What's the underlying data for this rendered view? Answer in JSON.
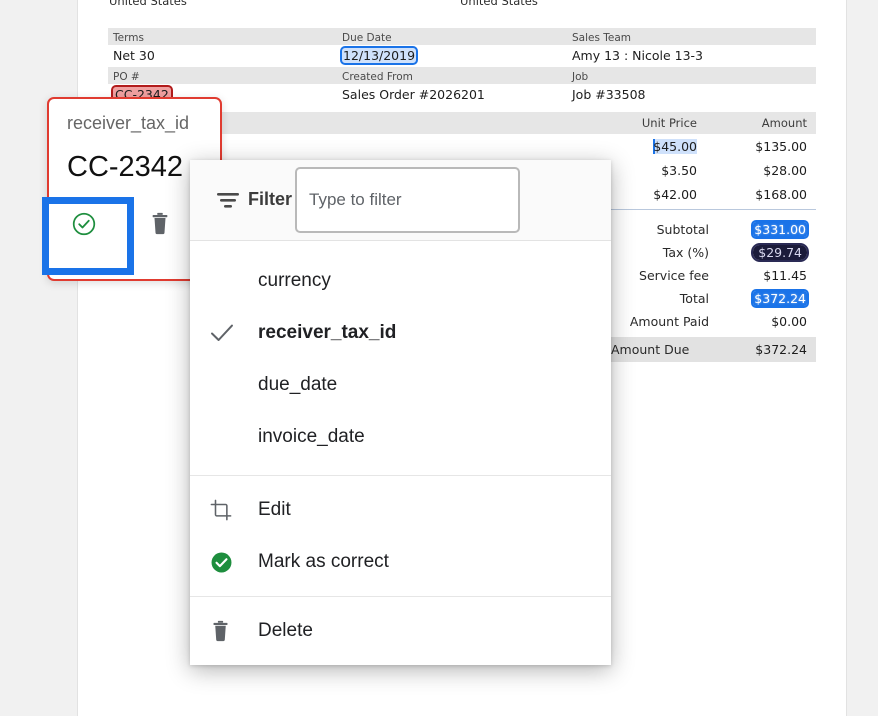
{
  "document": {
    "address_left": "United States",
    "address_right": "United States",
    "meta_rows": [
      {
        "headers": [
          "Terms",
          "Due Date",
          "Sales Team"
        ],
        "values": [
          "Net 30",
          "12/13/2019",
          "Amy 13 : Nicole 13-3"
        ],
        "highlight": [
          "none",
          "blue",
          "none"
        ]
      },
      {
        "headers": [
          "PO #",
          "Created From",
          "Job"
        ],
        "values": [
          "CC-2342",
          "Sales Order #2026201",
          "Job #33508"
        ],
        "highlight": [
          "red",
          "none",
          "none"
        ]
      }
    ],
    "line_items": {
      "headers": [
        "",
        "Unit Price",
        "Amount"
      ],
      "rows": [
        {
          "description": "",
          "unit_price": "$45.00",
          "amount": "$135.00",
          "unit_price_highlight": "caret"
        },
        {
          "description": "",
          "unit_price": "$3.50",
          "amount": "$28.00",
          "unit_price_highlight": "none"
        },
        {
          "description": "",
          "unit_price": "$42.00",
          "amount": "$168.00",
          "unit_price_highlight": "none"
        }
      ]
    },
    "totals": [
      {
        "label": "Subtotal",
        "value": "$331.00",
        "highlight": "blue-solid"
      },
      {
        "label": "Tax (%)",
        "value": "$29.74",
        "highlight": "dark"
      },
      {
        "label": "Service fee",
        "value": "$11.45",
        "highlight": "none"
      },
      {
        "label": "Total",
        "value": "$372.24",
        "highlight": "blue-solid"
      },
      {
        "label": "Amount Paid",
        "value": "$0.00",
        "highlight": "none"
      }
    ],
    "amount_due": {
      "label": "Amount Due",
      "value": "$372.24"
    }
  },
  "field_card": {
    "key": "receiver_tax_id",
    "value": "CC-2342",
    "approve_title": "Mark as correct",
    "delete_title": "Delete"
  },
  "menu": {
    "filter_label": "Filter",
    "filter_placeholder": "Type to filter",
    "filter_value": "",
    "fields": [
      {
        "label": "currency",
        "selected": false
      },
      {
        "label": "receiver_tax_id",
        "selected": true
      },
      {
        "label": "due_date",
        "selected": false
      },
      {
        "label": "invoice_date",
        "selected": false
      }
    ],
    "actions": [
      {
        "label": "Edit",
        "icon": "crop-icon"
      },
      {
        "label": "Mark as correct",
        "icon": "check-circle-filled-icon"
      }
    ],
    "destructive": [
      {
        "label": "Delete",
        "icon": "trash-icon"
      }
    ]
  },
  "colors": {
    "accent_blue": "#1a73e8",
    "danger_red": "#e03b30",
    "success_green": "#1e8e3e",
    "page_bg": "#f1f1f1"
  }
}
